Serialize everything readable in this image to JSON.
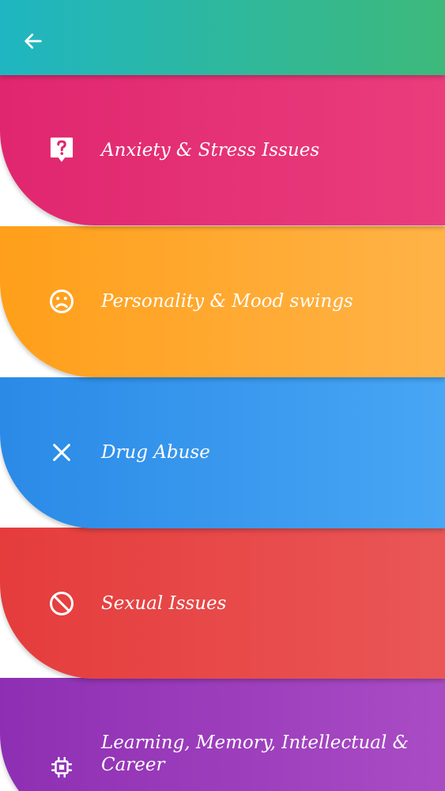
{
  "appbar": {
    "back_icon": "arrow-left-icon",
    "gradient": [
      "#1fb6c2",
      "#3db97a"
    ]
  },
  "categories": [
    {
      "label": "Anxiety & Stress Issues",
      "icon": "help-bubble-icon",
      "colors": [
        "#e0266f",
        "#ea3d7c"
      ]
    },
    {
      "label": "Personality & Mood swings",
      "icon": "sad-face-icon",
      "colors": [
        "#ff9f1a",
        "#ffb347"
      ]
    },
    {
      "label": "Drug Abuse",
      "icon": "close-icon",
      "colors": [
        "#2a8ae6",
        "#48a6f5"
      ]
    },
    {
      "label": "Sexual Issues",
      "icon": "block-icon",
      "colors": [
        "#e53c3c",
        "#ea5656"
      ]
    },
    {
      "label": "Learning, Memory, Intellectual & Career",
      "icon": "chip-icon",
      "colors": [
        "#8e2fb3",
        "#a94cc4"
      ]
    }
  ]
}
